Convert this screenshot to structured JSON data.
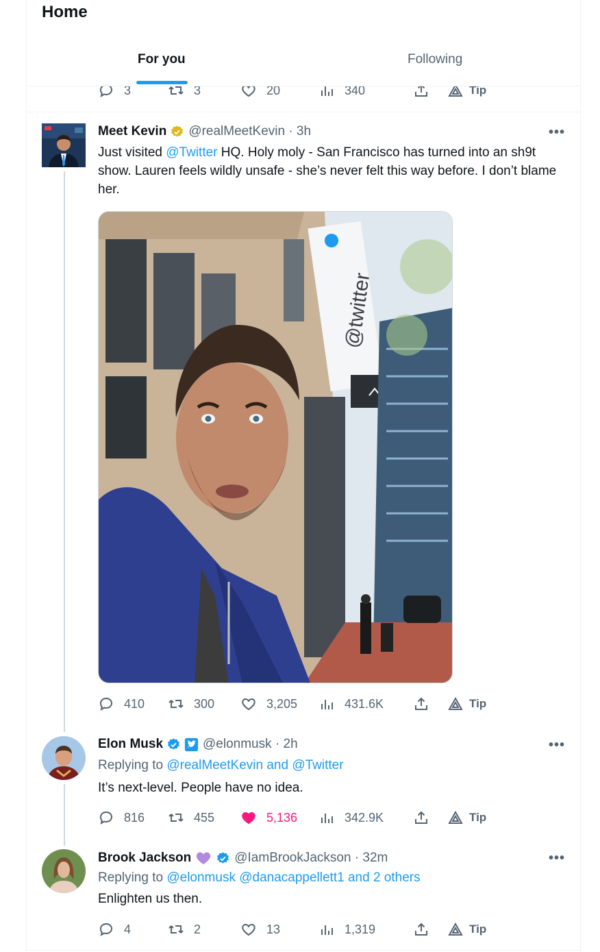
{
  "header": {
    "title": "Home",
    "tabs": [
      "For you",
      "Following"
    ]
  },
  "prev_tweet": {
    "actions": {
      "replies": "3",
      "retweets": "3",
      "likes": "20",
      "views": "340",
      "tip": "Tip"
    }
  },
  "tweet1": {
    "name": "Meet Kevin",
    "handle": "@realMeetKevin · 3h",
    "text_prefix": "Just visited ",
    "text_link": "@Twitter",
    "text_rest": " HQ. Holy moly - San Francisco has turned into an sh9t show. Lauren feels wildly unsafe - she’s never felt this way before. I don’t blame her.",
    "media_sign": "@twitter",
    "actions": {
      "replies": "410",
      "retweets": "300",
      "likes": "3,205",
      "views": "431.6K",
      "tip": "Tip"
    }
  },
  "tweet2": {
    "name": "Elon Musk",
    "handle": "@elonmusk · 2h",
    "replying_prefix": "Replying to ",
    "replying_to": "@realMeetKevin and @Twitter",
    "text": "It’s next-level. People have no idea.",
    "actions": {
      "replies": "816",
      "retweets": "455",
      "likes": "5,136",
      "views": "342.9K",
      "tip": "Tip"
    }
  },
  "tweet3": {
    "name": "Brook Jackson",
    "handle": "@IamBrookJackson · 32m",
    "replying_prefix": "Replying to ",
    "replying_to": "@elonmusk @danacappellett1 and 2 others",
    "text": "Enlighten us then.",
    "actions": {
      "replies": "4",
      "retweets": "2",
      "likes": "13",
      "views": "1,319",
      "tip": "Tip"
    }
  },
  "more_label": "•••",
  "colors": {
    "accent": "#1d9bf0",
    "like": "#f91880",
    "gold_badge": "#e2b719",
    "muted": "#536471"
  }
}
